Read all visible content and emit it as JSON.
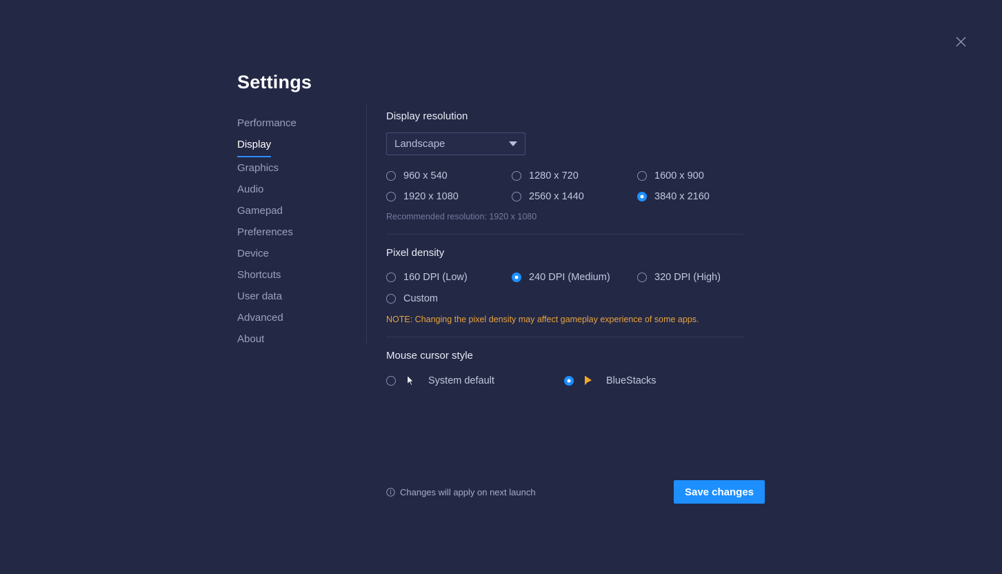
{
  "window": {
    "title": "Settings",
    "close_icon": "close-icon"
  },
  "sidebar": {
    "items": [
      {
        "label": "Performance",
        "active": false
      },
      {
        "label": "Display",
        "active": true
      },
      {
        "label": "Graphics",
        "active": false
      },
      {
        "label": "Audio",
        "active": false
      },
      {
        "label": "Gamepad",
        "active": false
      },
      {
        "label": "Preferences",
        "active": false
      },
      {
        "label": "Device",
        "active": false
      },
      {
        "label": "Shortcuts",
        "active": false
      },
      {
        "label": "User data",
        "active": false
      },
      {
        "label": "Advanced",
        "active": false
      },
      {
        "label": "About",
        "active": false
      }
    ]
  },
  "display_resolution": {
    "section_title": "Display resolution",
    "orientation_dropdown": {
      "selected": "Landscape",
      "caret_icon": "chevron-down-icon"
    },
    "options": [
      {
        "label": "960 x 540",
        "selected": false
      },
      {
        "label": "1280 x 720",
        "selected": false
      },
      {
        "label": "1600 x 900",
        "selected": false
      },
      {
        "label": "1920 x 1080",
        "selected": false
      },
      {
        "label": "2560 x 1440",
        "selected": false
      },
      {
        "label": "3840 x 2160",
        "selected": true
      }
    ],
    "recommended": "Recommended resolution: 1920 x 1080"
  },
  "pixel_density": {
    "section_title": "Pixel density",
    "options": [
      {
        "label": "160 DPI (Low)",
        "selected": false
      },
      {
        "label": "240 DPI (Medium)",
        "selected": true
      },
      {
        "label": "320 DPI (High)",
        "selected": false
      },
      {
        "label": "Custom",
        "selected": false
      }
    ],
    "note": "NOTE: Changing the pixel density may affect gameplay experience of some apps."
  },
  "mouse_cursor": {
    "section_title": "Mouse cursor style",
    "options": [
      {
        "label": "System default",
        "selected": false,
        "icon": "system-cursor-icon"
      },
      {
        "label": "BlueStacks",
        "selected": true,
        "icon": "bluestacks-cursor-icon"
      }
    ]
  },
  "footer": {
    "info_icon": "info-icon",
    "status_text": "Changes will apply on next launch",
    "save_label": "Save changes"
  },
  "colors": {
    "background": "#232845",
    "accent_blue": "#1e8fff",
    "note_orange": "#e8a33d",
    "cursor_gold": "#f0a828",
    "divider": "#343a5c"
  }
}
